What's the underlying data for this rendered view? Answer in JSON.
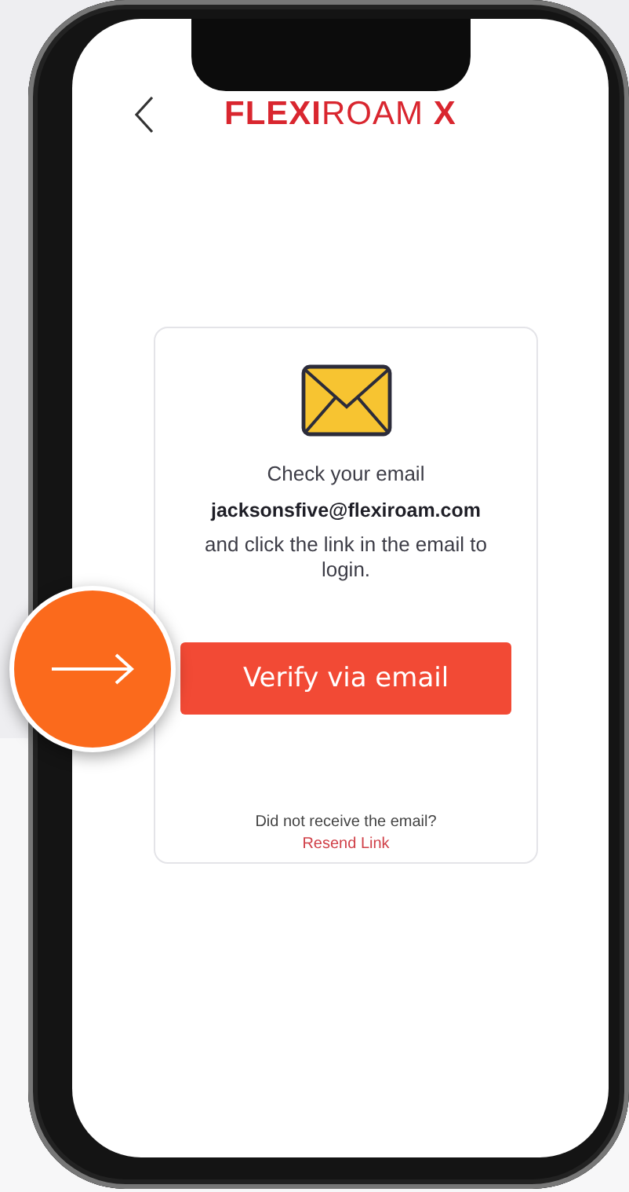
{
  "header": {
    "logo": "**FLEXI**ROAM **X**"
  },
  "card": {
    "title": "Check your email",
    "email": "jacksonsfive@flexiroam.com",
    "instruction": "and click the link in the email to login.",
    "button": "Verify via email",
    "prompt": "Did not receive the email?",
    "link": "Resend Link"
  }
}
